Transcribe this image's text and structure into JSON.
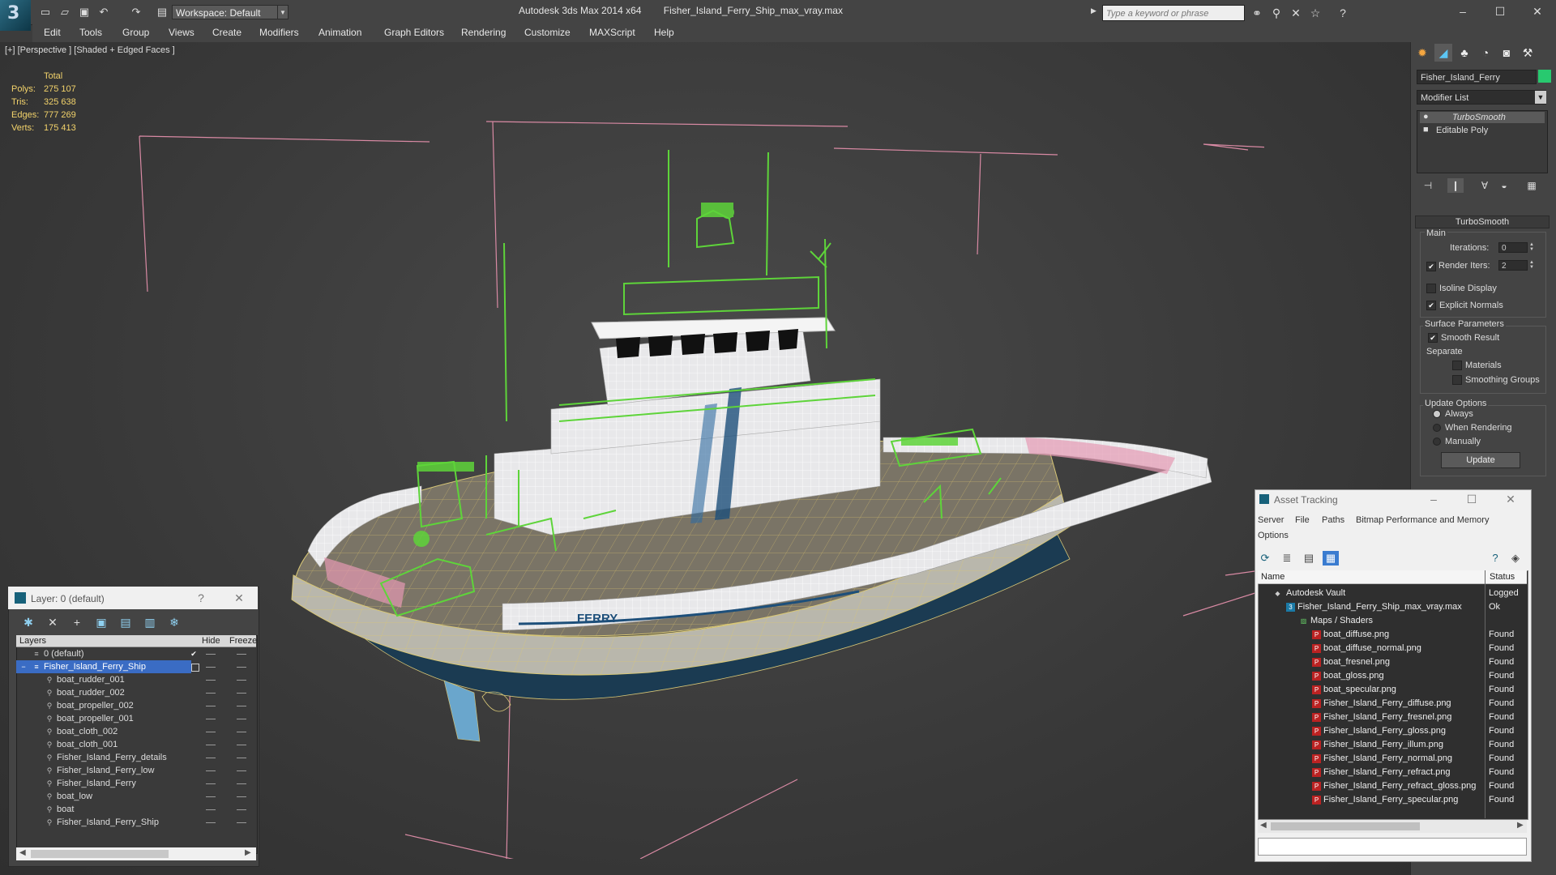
{
  "titlebar": {
    "workspace": "Workspace: Default",
    "app_title": "Autodesk 3ds Max  2014 x64",
    "file_name": "Fisher_Island_Ferry_Ship_max_vray.max",
    "search_placeholder": "Type a keyword or phrase"
  },
  "menu": [
    "Edit",
    "Tools",
    "Group",
    "Views",
    "Create",
    "Modifiers",
    "Animation",
    "Graph Editors",
    "Rendering",
    "Customize",
    "MAXScript",
    "Help"
  ],
  "viewport": {
    "label": "[+] [Perspective ] [Shaded + Edged Faces ]",
    "stats": {
      "header": "Total",
      "rows": [
        {
          "label": "Polys:",
          "value": "275 107"
        },
        {
          "label": "Tris:",
          "value": "325 638"
        },
        {
          "label": "Edges:",
          "value": "777 269"
        },
        {
          "label": "Verts:",
          "value": "175 413"
        }
      ]
    },
    "ferry_text": "FERRY"
  },
  "command_panel": {
    "object_name": "Fisher_Island_Ferry",
    "object_color": "#28c96f",
    "modifier_list": "Modifier List",
    "stack": [
      "TurboSmooth",
      "Editable Poly"
    ],
    "rollout": "TurboSmooth",
    "main_label": "Main",
    "iterations_label": "Iterations:",
    "iterations_value": "0",
    "render_iters_label": "Render Iters:",
    "render_iters_value": "2",
    "isoline": "Isoline Display",
    "explicit_normals": "Explicit Normals",
    "surface_params": "Surface Parameters",
    "smooth_result": "Smooth Result",
    "separate": "Separate",
    "materials": "Materials",
    "smoothing_groups": "Smoothing Groups",
    "update_options": "Update Options",
    "always": "Always",
    "when_rendering": "When Rendering",
    "manually": "Manually",
    "update_button": "Update"
  },
  "layer_dialog": {
    "title": "Layer: 0 (default)",
    "help": "?",
    "col_layers": "Layers",
    "col_hide": "Hide",
    "col_freeze": "Freeze",
    "rows": [
      "0 (default)",
      "Fisher_Island_Ferry_Ship",
      "boat_rudder_001",
      "boat_rudder_002",
      "boat_propeller_002",
      "boat_propeller_001",
      "boat_cloth_002",
      "boat_cloth_001",
      "Fisher_Island_Ferry_details",
      "Fisher_Island_Ferry_low",
      "Fisher_Island_Ferry",
      "boat_low",
      "boat",
      "Fisher_Island_Ferry_Ship"
    ]
  },
  "asset_tracking": {
    "title": "Asset Tracking",
    "menu": [
      "Server",
      "File",
      "Paths",
      "Bitmap Performance and Memory",
      "Options"
    ],
    "col_name": "Name",
    "col_status": "Status",
    "rows": [
      {
        "name": "Autodesk Vault",
        "status": "Logged"
      },
      {
        "name": "Fisher_Island_Ferry_Ship_max_vray.max",
        "status": "Ok"
      },
      {
        "name": "Maps / Shaders",
        "status": ""
      },
      {
        "name": "boat_diffuse.png",
        "status": "Found"
      },
      {
        "name": "boat_diffuse_normal.png",
        "status": "Found"
      },
      {
        "name": "boat_fresnel.png",
        "status": "Found"
      },
      {
        "name": "boat_gloss.png",
        "status": "Found"
      },
      {
        "name": "boat_specular.png",
        "status": "Found"
      },
      {
        "name": "Fisher_Island_Ferry_diffuse.png",
        "status": "Found"
      },
      {
        "name": "Fisher_Island_Ferry_fresnel.png",
        "status": "Found"
      },
      {
        "name": "Fisher_Island_Ferry_gloss.png",
        "status": "Found"
      },
      {
        "name": "Fisher_Island_Ferry_illum.png",
        "status": "Found"
      },
      {
        "name": "Fisher_Island_Ferry_normal.png",
        "status": "Found"
      },
      {
        "name": "Fisher_Island_Ferry_refract.png",
        "status": "Found"
      },
      {
        "name": "Fisher_Island_Ferry_refract_gloss.png",
        "status": "Found"
      },
      {
        "name": "Fisher_Island_Ferry_specular.png",
        "status": "Found"
      }
    ]
  },
  "colors": {
    "wire_green": "#5ed43a",
    "selection_pink": "#e08aa8",
    "stats_yellow": "#f3d36b",
    "hull_blue": "#1d4f7a"
  }
}
